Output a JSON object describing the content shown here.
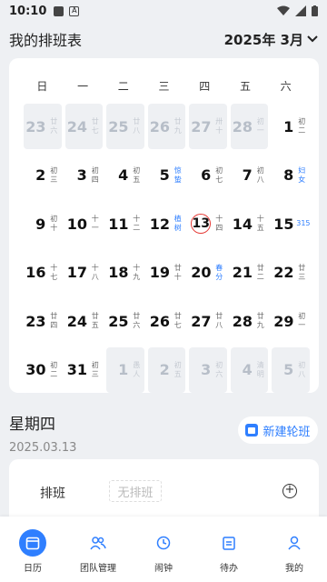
{
  "status": {
    "time": "10:10"
  },
  "header": {
    "title": "我的排班表",
    "month": "2025年 3月"
  },
  "weekdays": [
    "日",
    "一",
    "二",
    "三",
    "四",
    "五",
    "六"
  ],
  "calendar": {
    "rows": [
      [
        {
          "d": "23",
          "l": "廿六",
          "o": true
        },
        {
          "d": "24",
          "l": "廿七",
          "o": true
        },
        {
          "d": "25",
          "l": "廿八",
          "o": true
        },
        {
          "d": "26",
          "l": "廿九",
          "o": true
        },
        {
          "d": "27",
          "l": "卅十",
          "o": true
        },
        {
          "d": "28",
          "l": "初一",
          "o": true
        },
        {
          "d": "1",
          "l": "初二"
        }
      ],
      [
        {
          "d": "2",
          "l": "初三"
        },
        {
          "d": "3",
          "l": "初四"
        },
        {
          "d": "4",
          "l": "初五"
        },
        {
          "d": "5",
          "l": "惊蛰",
          "t": true
        },
        {
          "d": "6",
          "l": "初七"
        },
        {
          "d": "7",
          "l": "初八"
        },
        {
          "d": "8",
          "l": "妇女",
          "t": true
        }
      ],
      [
        {
          "d": "9",
          "l": "初十"
        },
        {
          "d": "10",
          "l": "十一"
        },
        {
          "d": "11",
          "l": "十二"
        },
        {
          "d": "12",
          "l": "植树",
          "t": true
        },
        {
          "d": "13",
          "l": "十四",
          "today": true
        },
        {
          "d": "14",
          "l": "十五"
        },
        {
          "d": "15",
          "l": "315",
          "t": true
        }
      ],
      [
        {
          "d": "16",
          "l": "十七"
        },
        {
          "d": "17",
          "l": "十八"
        },
        {
          "d": "18",
          "l": "十九"
        },
        {
          "d": "19",
          "l": "廿十"
        },
        {
          "d": "20",
          "l": "春分",
          "t": true
        },
        {
          "d": "21",
          "l": "廿二"
        },
        {
          "d": "22",
          "l": "廿三"
        }
      ],
      [
        {
          "d": "23",
          "l": "廿四"
        },
        {
          "d": "24",
          "l": "廿五"
        },
        {
          "d": "25",
          "l": "廿六"
        },
        {
          "d": "26",
          "l": "廿七"
        },
        {
          "d": "27",
          "l": "廿八"
        },
        {
          "d": "28",
          "l": "廿九"
        },
        {
          "d": "29",
          "l": "初一"
        }
      ],
      [
        {
          "d": "30",
          "l": "初二"
        },
        {
          "d": "31",
          "l": "初三"
        },
        {
          "d": "1",
          "l": "愚人",
          "o": true
        },
        {
          "d": "2",
          "l": "初五",
          "o": true
        },
        {
          "d": "3",
          "l": "初六",
          "o": true
        },
        {
          "d": "4",
          "l": "清明",
          "o": true
        },
        {
          "d": "5",
          "l": "初八",
          "o": true
        }
      ]
    ]
  },
  "selected": {
    "weekday": "星期四",
    "date": "2025.03.13"
  },
  "new_shift_label": "新建轮班",
  "shift_card": {
    "label": "排班",
    "none": "无排班"
  },
  "tabs": [
    "日历",
    "团队管理",
    "闹钟",
    "待办",
    "我的"
  ],
  "colors": {
    "accent": "#2f7fff",
    "today_ring": "#e53935"
  }
}
